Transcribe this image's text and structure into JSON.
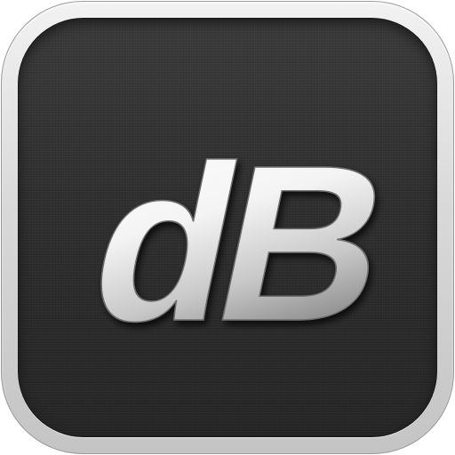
{
  "logo": {
    "text": "dB",
    "fill_top": "#ffffff",
    "fill_bottom": "#9a9a9a",
    "face_color": "#2f2f2f",
    "bezel_color": "#dcdcdc"
  }
}
